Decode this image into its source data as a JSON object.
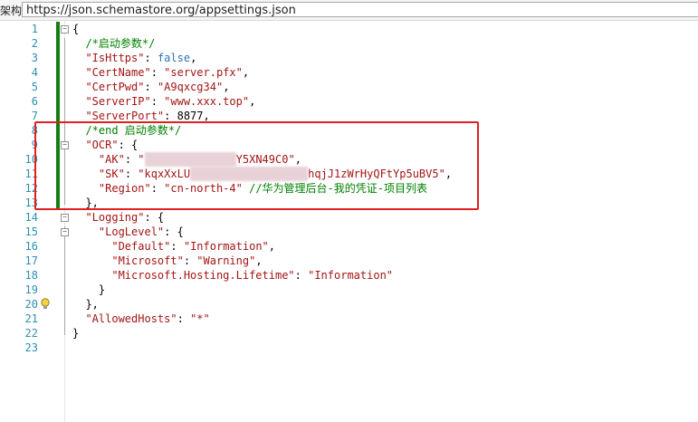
{
  "schema": {
    "label": "架构:",
    "url": "https://json.schemastore.org/appsettings.json"
  },
  "colors": {
    "key": "#2e75b6",
    "string": "#a31515",
    "comment": "#008000",
    "linenum": "#2b91af",
    "changed": "#108010",
    "highlight_box": "#e02020"
  },
  "lines": [
    {
      "n": "1",
      "t": [
        [
          "p",
          "{"
        ]
      ]
    },
    {
      "n": "2",
      "t": [
        [
          "p",
          "  "
        ],
        [
          "c",
          "/*启动参数*/"
        ]
      ]
    },
    {
      "n": "3",
      "t": [
        [
          "p",
          "  "
        ],
        [
          "s",
          "\"IsHttps\""
        ],
        [
          "p",
          ": "
        ],
        [
          "k",
          "false"
        ],
        [
          "p",
          ","
        ]
      ]
    },
    {
      "n": "4",
      "t": [
        [
          "p",
          "  "
        ],
        [
          "s",
          "\"CertName\""
        ],
        [
          "p",
          ": "
        ],
        [
          "s",
          "\"server.pfx\""
        ],
        [
          "p",
          ","
        ]
      ]
    },
    {
      "n": "5",
      "t": [
        [
          "p",
          "  "
        ],
        [
          "s",
          "\"CertPwd\""
        ],
        [
          "p",
          ": "
        ],
        [
          "s",
          "\"A9qxcg34\""
        ],
        [
          "p",
          ","
        ]
      ]
    },
    {
      "n": "6",
      "t": [
        [
          "p",
          "  "
        ],
        [
          "s",
          "\"ServerIP\""
        ],
        [
          "p",
          ": "
        ],
        [
          "s",
          "\"www.xxx.top\""
        ],
        [
          "p",
          ","
        ]
      ]
    },
    {
      "n": "7",
      "t": [
        [
          "p",
          "  "
        ],
        [
          "s",
          "\"ServerPort\""
        ],
        [
          "p",
          ": "
        ],
        [
          "p",
          "8877"
        ],
        [
          "p",
          ","
        ]
      ]
    },
    {
      "n": "8",
      "t": [
        [
          "p",
          "  "
        ],
        [
          "c",
          "/*end 启动参数*/"
        ]
      ]
    },
    {
      "n": "9",
      "t": [
        [
          "p",
          "  "
        ],
        [
          "s",
          "\"OCR\""
        ],
        [
          "p",
          ": {"
        ]
      ]
    },
    {
      "n": "10",
      "t": [
        [
          "p",
          "    "
        ],
        [
          "s",
          "\"AK\""
        ],
        [
          "p",
          ": "
        ],
        [
          "s",
          "\""
        ],
        [
          "b",
          "xxxxxxxxxxxxxx"
        ],
        [
          "s",
          "Y5XN49C0\""
        ],
        [
          "p",
          ","
        ]
      ]
    },
    {
      "n": "11",
      "t": [
        [
          "p",
          "    "
        ],
        [
          "s",
          "\"SK\""
        ],
        [
          "p",
          ": "
        ],
        [
          "s",
          "\"kqxXxLU"
        ],
        [
          "b",
          "xxxxxxxxxxxxxxxxxx"
        ],
        [
          "s",
          "hqjJ1zWrHyQFtYp5uBV5\""
        ],
        [
          "p",
          ","
        ]
      ]
    },
    {
      "n": "12",
      "t": [
        [
          "p",
          "    "
        ],
        [
          "s",
          "\"Region\""
        ],
        [
          "p",
          ": "
        ],
        [
          "s",
          "\"cn-north-4\""
        ],
        [
          "p",
          " "
        ],
        [
          "c",
          "//华为管理后台-我的凭证-项目列表"
        ]
      ]
    },
    {
      "n": "13",
      "t": [
        [
          "p",
          "  },"
        ]
      ]
    },
    {
      "n": "14",
      "t": [
        [
          "p",
          "  "
        ],
        [
          "s",
          "\"Logging\""
        ],
        [
          "p",
          ": {"
        ]
      ]
    },
    {
      "n": "15",
      "t": [
        [
          "p",
          "    "
        ],
        [
          "s",
          "\"LogLevel\""
        ],
        [
          "p",
          ": {"
        ]
      ]
    },
    {
      "n": "16",
      "t": [
        [
          "p",
          "      "
        ],
        [
          "s",
          "\"Default\""
        ],
        [
          "p",
          ": "
        ],
        [
          "s",
          "\"Information\""
        ],
        [
          "p",
          ","
        ]
      ]
    },
    {
      "n": "17",
      "t": [
        [
          "p",
          "      "
        ],
        [
          "s",
          "\"Microsoft\""
        ],
        [
          "p",
          ": "
        ],
        [
          "s",
          "\"Warning\""
        ],
        [
          "p",
          ","
        ]
      ]
    },
    {
      "n": "18",
      "t": [
        [
          "p",
          "      "
        ],
        [
          "s",
          "\"Microsoft.Hosting.Lifetime\""
        ],
        [
          "p",
          ": "
        ],
        [
          "s",
          "\"Information\""
        ]
      ]
    },
    {
      "n": "19",
      "t": [
        [
          "p",
          "    }"
        ]
      ]
    },
    {
      "n": "20",
      "t": [
        [
          "p",
          "  },"
        ]
      ]
    },
    {
      "n": "21",
      "t": [
        [
          "p",
          "  "
        ],
        [
          "s",
          "\"AllowedHosts\""
        ],
        [
          "p",
          ": "
        ],
        [
          "s",
          "\"*\""
        ]
      ]
    },
    {
      "n": "22",
      "t": [
        [
          "p",
          "}"
        ]
      ]
    },
    {
      "n": "23",
      "t": []
    }
  ],
  "changed_lines": [
    "1",
    "2",
    "3",
    "4",
    "5",
    "6",
    "7",
    "8",
    "9",
    "10",
    "11",
    "12",
    "13"
  ],
  "fold_lines": [
    "1",
    "9",
    "14",
    "15"
  ],
  "bulb_line": "20"
}
